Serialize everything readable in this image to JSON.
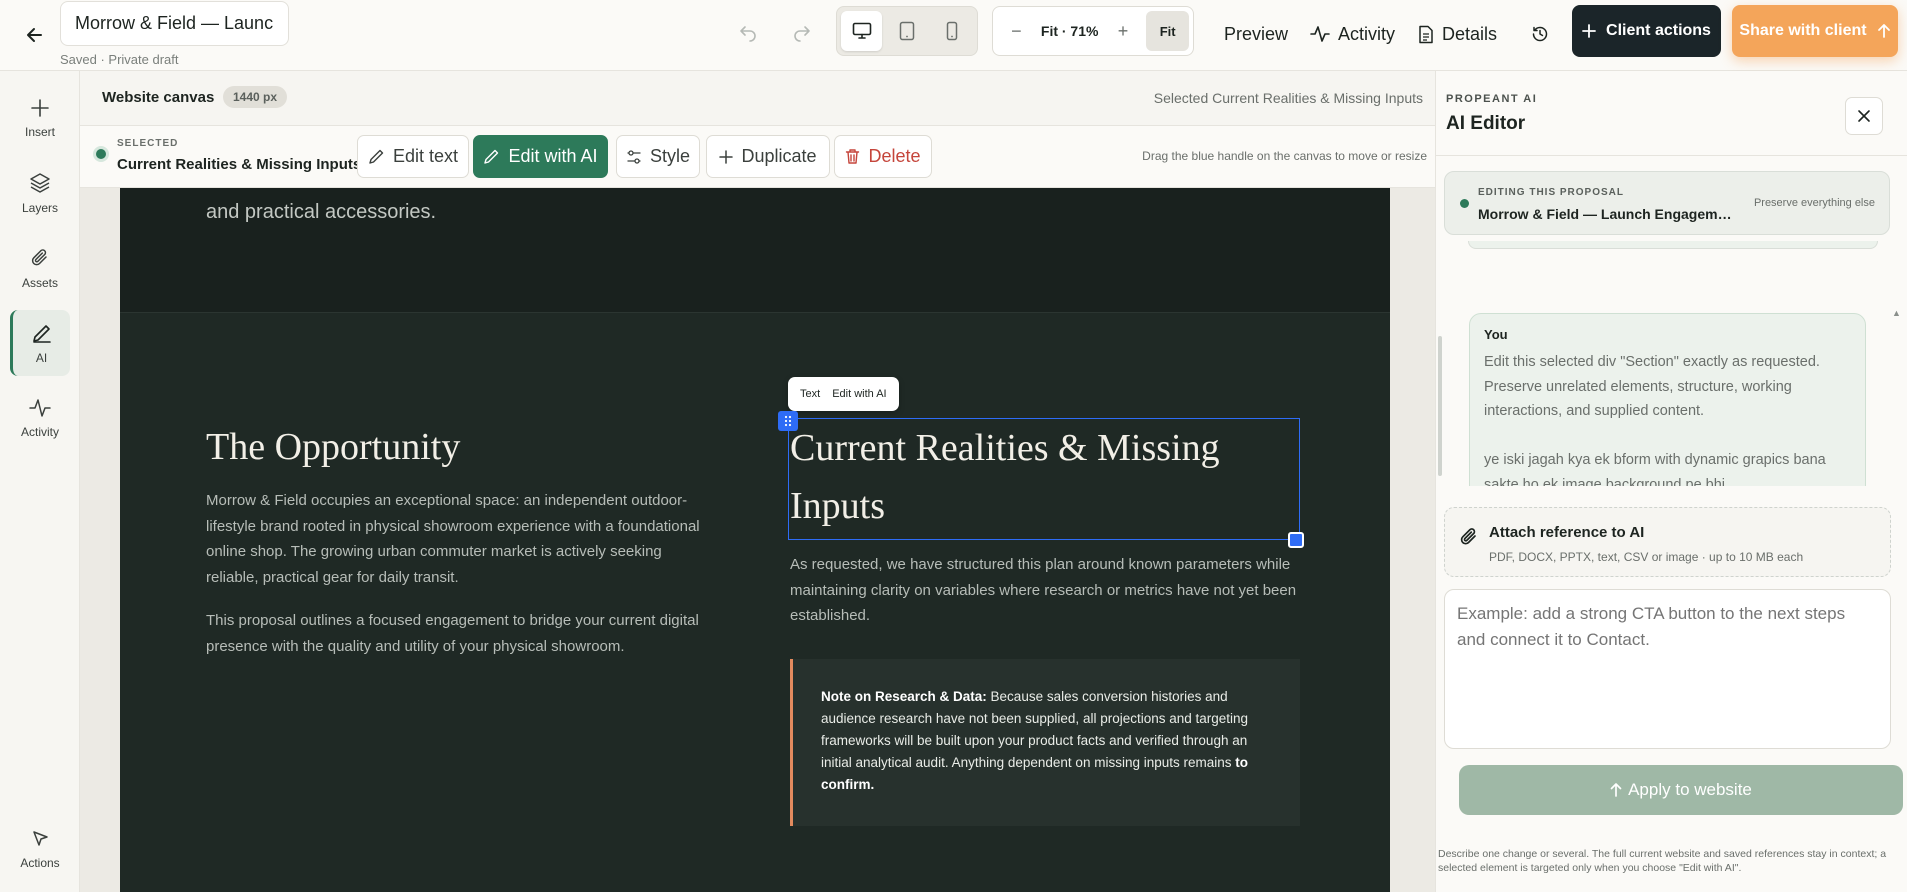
{
  "header": {
    "document_title": "Morrow & Field — Launch Engagement",
    "saved_status": "Saved · Private draft",
    "zoom_label": "Fit · 71%",
    "zoom_out": "−",
    "zoom_in": "+",
    "fit_label": "Fit",
    "preview_label": "Preview",
    "activity_label": "Activity",
    "details_label": "Details",
    "client_actions_label": "Client actions",
    "share_label": "Share with client"
  },
  "rail": {
    "insert": "Insert",
    "layers": "Layers",
    "assets": "Assets",
    "ai": "AI",
    "activity": "Activity",
    "actions": "Actions"
  },
  "canvas": {
    "title": "Website canvas",
    "width_badge": "1440 px",
    "selected_label": "Selected Current Realities & Missing Inputs"
  },
  "selection": {
    "kicker": "SELECTED",
    "name": "Current Realities & Missing Inputs",
    "edit_text": "Edit text",
    "edit_ai": "Edit with AI",
    "style": "Style",
    "duplicate": "Duplicate",
    "delete": "Delete",
    "hint": "Drag the blue handle on the canvas to move or resize"
  },
  "site": {
    "hero_tail": "and practical accessories.",
    "left_heading": "The Opportunity",
    "left_p1": "Morrow & Field occupies an exceptional space: an independent outdoor-lifestyle brand rooted in physical showroom experience with a foundational online shop. The growing urban commuter market is actively seeking reliable, practical gear for daily transit.",
    "left_p2": "This proposal outlines a focused engagement to bridge your current digital presence with the quality and utility of your physical showroom.",
    "right_heading": "Current Realities & Missing Inputs",
    "right_body": "As requested, we have structured this plan around known parameters while maintaining clarity on variables where research or metrics have not yet been established.",
    "note_label": "Note on Research & Data:",
    "note_body": " Because sales conversion histories and audience research have not been supplied, all projections and targeting frameworks will be built upon your product facts and verified through an initial analytical audit. Anything dependent on missing inputs remains ",
    "note_emphasis": "to confirm.",
    "float_text": "Text",
    "float_edit_ai": "Edit with AI"
  },
  "ai_panel": {
    "kicker": "PROPEANT AI",
    "title": "AI Editor",
    "proposal_kicker": "EDITING THIS PROPOSAL",
    "proposal_name": "Morrow & Field — Launch Engagement",
    "proposal_hint": "Preserve everything else",
    "chat_author": "You",
    "chat_text": "Edit this selected div \"Section\" exactly as requested. Preserve unrelated elements, structure, working interactions, and supplied content.\n\nye iski jagah kya ek bform with dynamic grapics bana sakte ho ek image background pe bhi",
    "attach_title": "Attach reference to AI",
    "attach_hint": "PDF, DOCX, PPTX, text, CSV or image · up to 10 MB each",
    "prompt_placeholder": "Example: add a strong CTA button to the next steps and connect it to Contact.",
    "apply_label": "Apply to website",
    "footer": "Describe one change or several. The full current website and saved references stay in context; a selected element is targeted only when you choose \"Edit with AI\"."
  },
  "colors": {
    "accent_green": "#2d7a5a",
    "selection_blue": "#2e6cf6",
    "share_orange": "#f4a55a",
    "site_dark": "#1f2925",
    "note_border": "#e28a5e"
  },
  "icons": [
    "back-arrow-icon",
    "undo-icon",
    "redo-icon",
    "desktop-icon",
    "tablet-icon",
    "mobile-icon",
    "activity-icon",
    "document-icon",
    "history-icon",
    "plus-icon",
    "layers-icon",
    "paperclip-icon",
    "pen-icon",
    "cursor-icon",
    "trash-icon",
    "sliders-icon",
    "close-icon",
    "arrow-up-icon"
  ]
}
